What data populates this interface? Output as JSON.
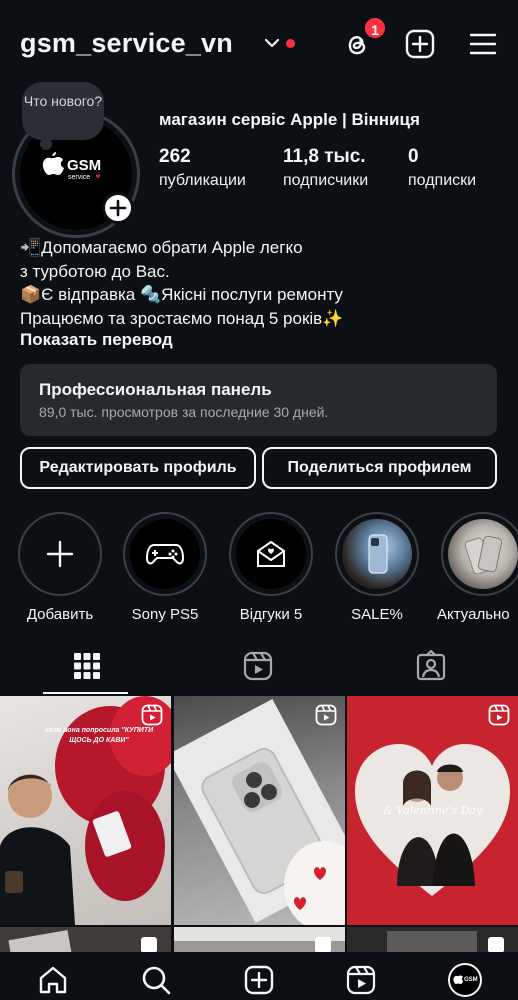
{
  "header": {
    "username": "gsm_service_vn",
    "threads_badge": "1"
  },
  "profile": {
    "note": "Что нового?",
    "logo_text": "GSM",
    "logo_sub": "service",
    "name": "магазин сервіс Apple | Вінниця",
    "stats": [
      {
        "value": "262",
        "label": "публикации"
      },
      {
        "value": "11,8 тыс.",
        "label": "подписчики"
      },
      {
        "value": "0",
        "label": "подписки"
      }
    ],
    "bio": [
      "📲Допомагаємо обрати Apple легко",
      "з турботою до Вас.",
      "📦Є відправка 🔩Якісні послуги ремонту",
      "Працюємо та зростаємо понад 5 років✨"
    ],
    "translate_label": "Показать перевод"
  },
  "pro_panel": {
    "title": "Профессиональная панель",
    "subtitle": "89,0 тыс. просмотров за последние 30 дней."
  },
  "buttons": {
    "edit": "Редактировать профиль",
    "share": "Поделиться профилем"
  },
  "highlights": [
    {
      "label": "Добавить",
      "icon": "plus-icon"
    },
    {
      "label": "Sony PS5",
      "icon": "gamepad-icon"
    },
    {
      "label": "Відгуки 5",
      "icon": "envelope-heart-icon"
    },
    {
      "label": "SALE%",
      "icon": "iphone-photo"
    },
    {
      "label": "Актуально",
      "icon": "iphone-photo"
    }
  ],
  "posts": {
    "p1_caption": "коли вона попросила \"КУПИТИ ЩОСЬ ДО КАВИ\"",
    "p3_caption": "& Valentine's Day"
  },
  "colors": {
    "background": "#0c1014",
    "panel": "#262a2f",
    "badge_red": "#ff3040",
    "text": "#f5f5f5"
  }
}
